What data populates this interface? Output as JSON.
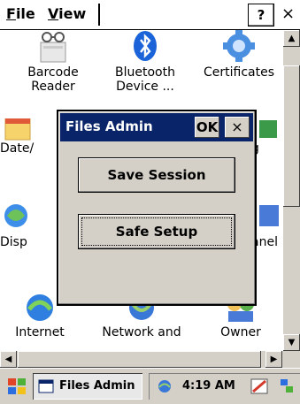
{
  "menubar": {
    "file": "File",
    "view": "View",
    "help": "?",
    "close": "×"
  },
  "icons": [
    {
      "id": "barcode",
      "label1": "Barcode",
      "label2": "Reader"
    },
    {
      "id": "bluetooth",
      "label1": "Bluetooth",
      "label2": "Device ..."
    },
    {
      "id": "certificates",
      "label1": "Certificates",
      "label2": ""
    },
    {
      "id": "datetime",
      "label1": "Date/",
      "label2": ""
    },
    {
      "id": "row2right",
      "label1": "g",
      "label2": ""
    },
    {
      "id": "display",
      "label1": "Disp",
      "label2": ""
    },
    {
      "id": "panel",
      "label1": "anel",
      "label2": ""
    },
    {
      "id": "internet",
      "label1": "Internet",
      "label2": ""
    },
    {
      "id": "network",
      "label1": "Network and",
      "label2": ""
    },
    {
      "id": "owner",
      "label1": "Owner",
      "label2": ""
    }
  ],
  "dialog": {
    "title": "Files Admin",
    "ok": "OK",
    "close": "×",
    "save_session": "Save Session",
    "safe_setup": "Safe Setup"
  },
  "taskbar": {
    "task_label": "Files Admin",
    "clock": "4:19 AM"
  },
  "colors": {
    "titlebar": "#0a246a",
    "chrome": "#d4d0c8"
  }
}
